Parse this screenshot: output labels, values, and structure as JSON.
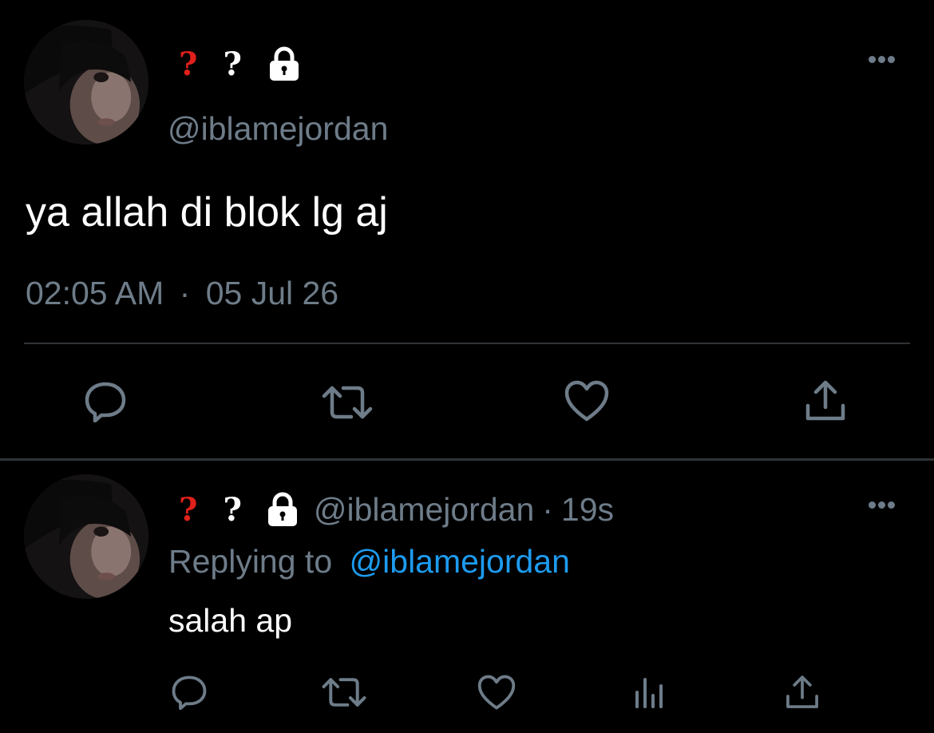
{
  "main_tweet": {
    "name_mark_1": "?",
    "name_mark_2": "?",
    "handle": "@iblamejordan",
    "text": "ya allah di blok lg aj",
    "time": "02:05 AM",
    "separator": "·",
    "date": "05 Jul 26"
  },
  "reply_tweet": {
    "name_mark_1": "?",
    "name_mark_2": "?",
    "handle": "@iblamejordan",
    "separator": "·",
    "age": "19s",
    "replying_to_label": "Replying to",
    "replying_to_handle": "@iblamejordan",
    "text": "salah ap"
  },
  "colors": {
    "background": "#000000",
    "muted": "#6e7c89",
    "link": "#1d9bf0",
    "red_mark": "#e0201b",
    "divider": "#2f3336"
  },
  "icons": {
    "main_actions": [
      "reply-icon",
      "retweet-icon",
      "like-icon",
      "share-icon"
    ],
    "reply_actions": [
      "reply-icon",
      "retweet-icon",
      "like-icon",
      "analytics-icon",
      "share-icon"
    ]
  }
}
